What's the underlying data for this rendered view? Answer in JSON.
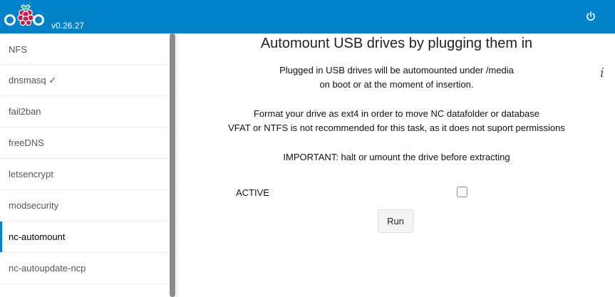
{
  "header": {
    "version": "v0.26.27",
    "logo_icon": "nextcloudpi-logo",
    "power_icon": "power-icon",
    "bg_color": "#0082c9"
  },
  "sidebar": {
    "items": [
      {
        "label": "NFS"
      },
      {
        "label": "dnsmasq ✓"
      },
      {
        "label": "fail2ban"
      },
      {
        "label": "freeDNS"
      },
      {
        "label": "letsencrypt"
      },
      {
        "label": "modsecurity"
      },
      {
        "label": "nc-automount",
        "active": true
      },
      {
        "label": "nc-autoupdate-ncp"
      }
    ]
  },
  "main": {
    "title": "Automount USB drives by plugging them in",
    "description": [
      "Plugged in USB drives will be automounted under /media",
      "on boot or at the moment of insertion.",
      "Format your drive as ext4 in order to move NC datafolder or database",
      "VFAT or NTFS is not recommended for this task, as it does not suport permissions",
      "IMPORTANT: halt or umount the drive before extracting"
    ],
    "info_icon": "i",
    "active_label": "ACTIVE",
    "active_checked": false,
    "run_label": "Run"
  }
}
